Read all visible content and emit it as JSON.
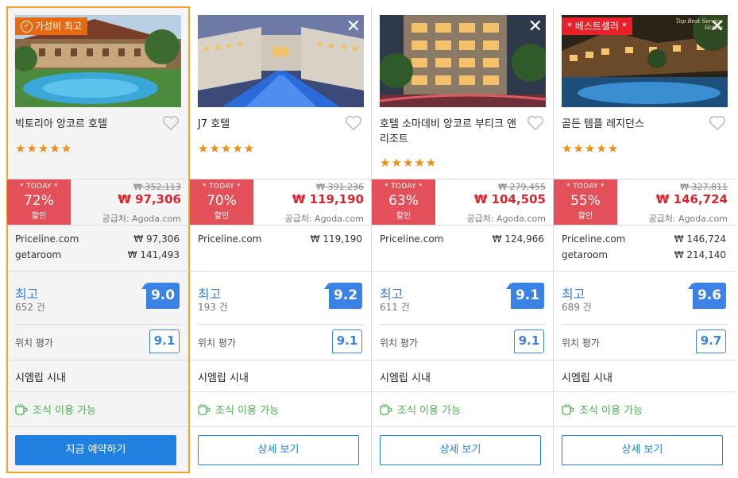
{
  "cards": [
    {
      "name": "빅토리아 앙코르 호텔",
      "badge": "가성비 최고",
      "badge_type": "value",
      "stars": "★★★★★",
      "today": "* TODAY *",
      "discount": "72%",
      "discount_label": "할인",
      "orig_price": "₩ 352,113",
      "price": "₩ 97,306",
      "supplier": "공급처: Agoda.com",
      "providers": [
        {
          "name": "Priceline.com",
          "price": "₩  97,306"
        },
        {
          "name": "getaroom",
          "price": "₩ 141,493"
        }
      ],
      "rating_label": "최고",
      "rating_count": "652 건",
      "rating_score": "9.0",
      "location_label": "위치 평가",
      "location_score": "9.1",
      "area": "시엠립 시내",
      "breakfast": "조식 이용 가능",
      "button": "지금 예약하기",
      "button_primary": true
    },
    {
      "name": "J7 호텔",
      "badge": "",
      "stars": "★★★★★",
      "today": "* TODAY *",
      "discount": "70%",
      "discount_label": "할인",
      "orig_price": "₩ 391,236",
      "price": "₩ 119,190",
      "supplier": "공급처: Agoda.com",
      "providers": [
        {
          "name": "Priceline.com",
          "price": "₩ 119,190"
        }
      ],
      "rating_label": "최고",
      "rating_count": "193 건",
      "rating_score": "9.2",
      "location_label": "위치 평가",
      "location_score": "9.1",
      "area": "시엠립 시내",
      "breakfast": "조식 이용 가능",
      "button": "상세 보기",
      "button_primary": false
    },
    {
      "name": "호텔 소마데비 앙코르 부티크 앤 리조트",
      "badge": "",
      "stars": "★★★★★",
      "today": "* TODAY *",
      "discount": "63%",
      "discount_label": "할인",
      "orig_price": "₩ 279,455",
      "price": "₩ 104,505",
      "supplier": "공급처: Agoda.com",
      "providers": [
        {
          "name": "Priceline.com",
          "price": "₩ 124,966"
        }
      ],
      "rating_label": "최고",
      "rating_count": "611 건",
      "rating_score": "9.1",
      "location_label": "위치 평가",
      "location_score": "9.1",
      "area": "시엠립 시내",
      "breakfast": "조식 이용 가능",
      "button": "상세 보기",
      "button_primary": false
    },
    {
      "name": "골든 템플 레지던스",
      "badge": "* 베스트셀러 *",
      "badge_type": "best",
      "photo_caption": "Top Best Service Hotels",
      "stars": "★★★★★",
      "today": "* TODAY *",
      "discount": "55%",
      "discount_label": "할인",
      "orig_price": "₩ 327,811",
      "price": "₩ 146,724",
      "supplier": "공급처: Agoda.com",
      "providers": [
        {
          "name": "Priceline.com",
          "price": "₩ 146,724"
        },
        {
          "name": "getaroom",
          "price": "₩ 214,140"
        }
      ],
      "rating_label": "최고",
      "rating_count": "689 건",
      "rating_score": "9.6",
      "location_label": "위치 평가",
      "location_score": "9.7",
      "area": "시엠립 시내",
      "breakfast": "조식 이용 가능",
      "button": "상세 보기",
      "button_primary": false
    }
  ],
  "colors": {
    "accent_orange": "#f7a325",
    "discount_red": "#e3505a",
    "price_red": "#d8262e",
    "score_blue": "#3b82e6",
    "button_blue": "#2081e0",
    "breakfast_green": "#4caf50"
  },
  "icons": {
    "close": "close-icon",
    "heart": "heart-icon",
    "cup": "coffee-cup-icon",
    "badge": "badge-icon"
  }
}
